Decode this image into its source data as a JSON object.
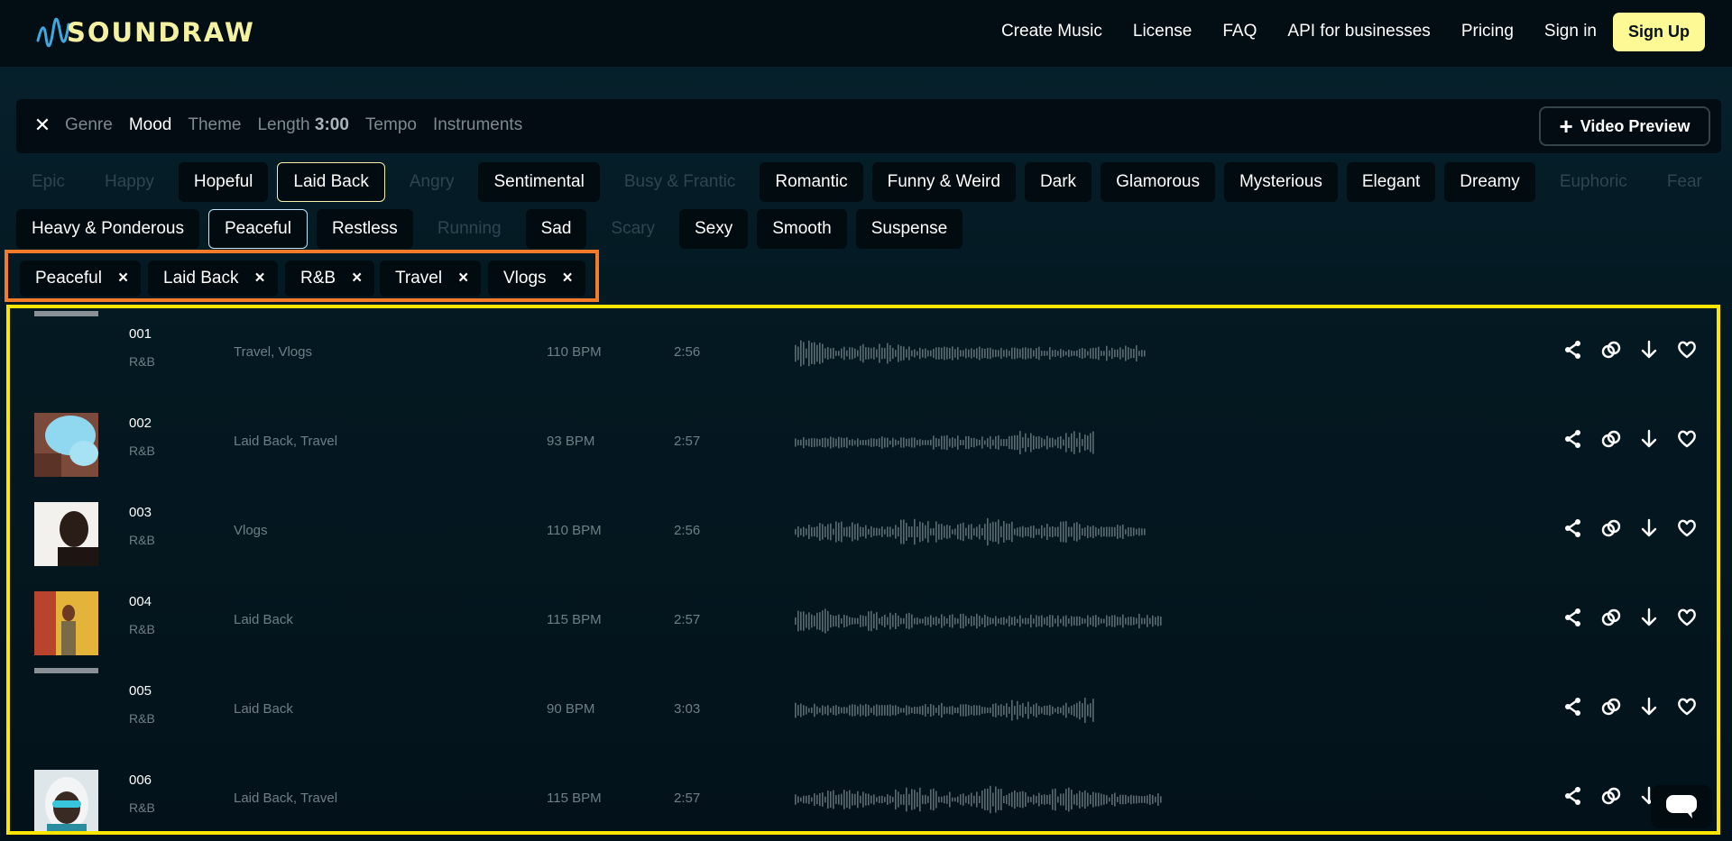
{
  "header": {
    "logo_text": "SOUNDRAW",
    "nav": [
      "Create Music",
      "License",
      "FAQ",
      "API for businesses",
      "Pricing",
      "Sign in"
    ],
    "signup_label": "Sign Up"
  },
  "filterbar": {
    "tabs": [
      {
        "label": "Genre",
        "active": false
      },
      {
        "label": "Mood",
        "active": true
      },
      {
        "label": "Theme",
        "active": false
      },
      {
        "label": "Length",
        "active": false
      },
      {
        "label": "Tempo",
        "active": false
      },
      {
        "label": "Instruments",
        "active": false
      }
    ],
    "length_value": "3:00",
    "video_preview_label": "Video Preview"
  },
  "moods_row1": [
    {
      "label": "Epic",
      "state": "off"
    },
    {
      "label": "Happy",
      "state": "off"
    },
    {
      "label": "Hopeful",
      "state": "on"
    },
    {
      "label": "Laid Back",
      "state": "selected"
    },
    {
      "label": "Angry",
      "state": "off"
    },
    {
      "label": "Sentimental",
      "state": "on"
    },
    {
      "label": "Busy & Frantic",
      "state": "off"
    },
    {
      "label": "Romantic",
      "state": "on"
    },
    {
      "label": "Funny & Weird",
      "state": "on"
    },
    {
      "label": "Dark",
      "state": "on"
    },
    {
      "label": "Glamorous",
      "state": "on"
    },
    {
      "label": "Mysterious",
      "state": "on"
    },
    {
      "label": "Elegant",
      "state": "on"
    },
    {
      "label": "Dreamy",
      "state": "on"
    },
    {
      "label": "Euphoric",
      "state": "off"
    },
    {
      "label": "Fear",
      "state": "off"
    }
  ],
  "moods_row2": [
    {
      "label": "Heavy & Ponderous",
      "state": "on"
    },
    {
      "label": "Peaceful",
      "state": "selected_blue"
    },
    {
      "label": "Restless",
      "state": "on"
    },
    {
      "label": "Running",
      "state": "off"
    },
    {
      "label": "Sad",
      "state": "on"
    },
    {
      "label": "Scary",
      "state": "off"
    },
    {
      "label": "Sexy",
      "state": "on"
    },
    {
      "label": "Smooth",
      "state": "on"
    },
    {
      "label": "Suspense",
      "state": "on"
    }
  ],
  "selected_tags": [
    "Peaceful",
    "Laid Back",
    "R&B",
    "Travel",
    "Vlogs"
  ],
  "tag_remove_glyph": "×",
  "tracks": [
    {
      "num": "001",
      "genre": "R&B",
      "tags": "Travel, Vlogs",
      "bpm": "110 BPM",
      "duration": "2:56",
      "thumb": "cut",
      "wave_len": 1
    },
    {
      "num": "002",
      "genre": "R&B",
      "tags": "Laid Back, Travel",
      "bpm": "93 BPM",
      "duration": "2:57",
      "thumb": "smoke",
      "wave_len": 0.86
    },
    {
      "num": "003",
      "genre": "R&B",
      "tags": "Vlogs",
      "bpm": "110 BPM",
      "duration": "2:56",
      "thumb": "man",
      "wave_len": 1
    },
    {
      "num": "004",
      "genre": "R&B",
      "tags": "Laid Back",
      "bpm": "115 BPM",
      "duration": "2:57",
      "thumb": "wall",
      "wave_len": 1.05
    },
    {
      "num": "005",
      "genre": "R&B",
      "tags": "Laid Back",
      "bpm": "90 BPM",
      "duration": "3:03",
      "thumb": "cut",
      "wave_len": 0.86
    },
    {
      "num": "006",
      "genre": "R&B",
      "tags": "Laid Back, Travel",
      "bpm": "115 BPM",
      "duration": "2:57",
      "thumb": "hoodie",
      "wave_len": 1.05
    }
  ],
  "track_actions": [
    "share-icon",
    "link-icon",
    "download-icon",
    "heart-icon"
  ],
  "colors": {
    "logo": "#f4f1a0",
    "signup_bg": "#fdfa96",
    "tags_box_border": "#f47b2a",
    "tracks_box_border": "#ffe600",
    "selected_chip_border": "#bfe8ff"
  }
}
